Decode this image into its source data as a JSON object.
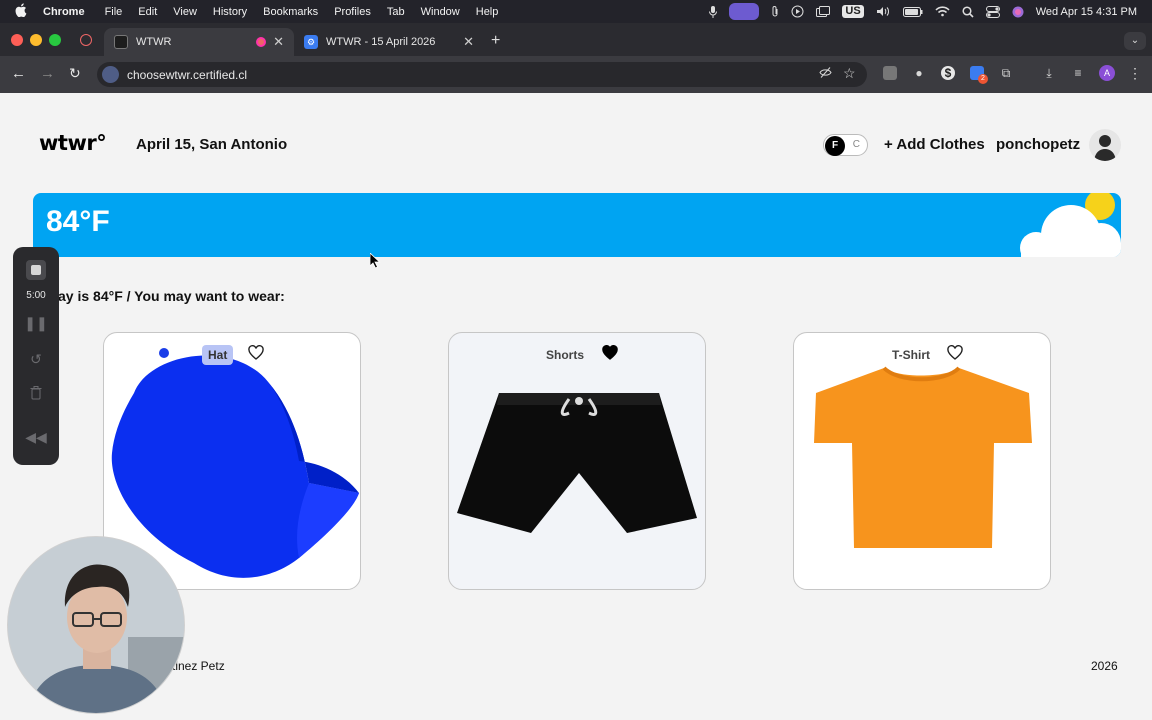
{
  "menubar": {
    "app": "Chrome",
    "items": [
      "File",
      "Edit",
      "View",
      "History",
      "Bookmarks",
      "Profiles",
      "Tab",
      "Window",
      "Help"
    ],
    "input_source": "US",
    "clock": "Wed Apr 15  4:31 PM"
  },
  "tabs": [
    {
      "title": "WTWR",
      "active": true
    },
    {
      "title": "WTWR - 15 April 2026",
      "active": false
    }
  ],
  "toolbar": {
    "url": "choosewtwr.certified.cl",
    "extension_badge": "2",
    "profile_initial": "A"
  },
  "header": {
    "logo": "wtwr°",
    "date_location": "April 15, San Antonio",
    "toggle": {
      "on": "F",
      "off": "C"
    },
    "add_clothes": "+ Add Clothes",
    "username": "ponchopetz"
  },
  "weather": {
    "temperature": "84°F",
    "bar_color": "#00a4f2"
  },
  "suggestion": "ay is 84°F / You may want to wear:",
  "cards": [
    {
      "label": "Hat",
      "liked": false
    },
    {
      "label": "Shorts",
      "liked": true
    },
    {
      "label": "T-Shirt",
      "liked": false
    }
  ],
  "footer": {
    "name": "rtinez Petz",
    "year": "2026"
  },
  "recorder": {
    "time": "5:00"
  }
}
